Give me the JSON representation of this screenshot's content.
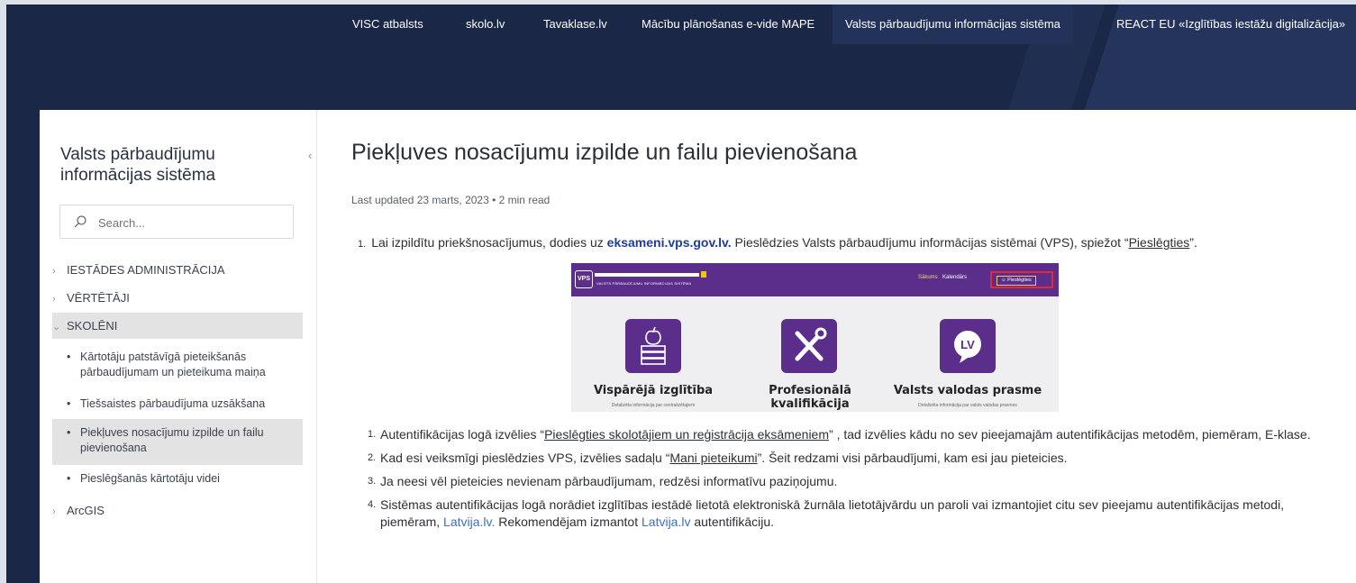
{
  "topnav": {
    "links": [
      {
        "label": "VISC atbalsts"
      },
      {
        "label": "skolo.lv"
      },
      {
        "label": "Tavaklase.lv"
      },
      {
        "label": "Mācību plānošanas e-vide MAPE"
      },
      {
        "label": "Valsts pārbaudījumu informācijas sistēma"
      },
      {
        "label": "REACT EU «Izglītības iestāžu digitalizācija»"
      }
    ]
  },
  "sidebar": {
    "title": "Valsts pārbaudījumu informācijas sistēma",
    "collapse_glyph": "‹",
    "search_placeholder": "Search...",
    "categories": [
      {
        "label": "IESTĀDES ADMINISTRĀCIJA",
        "chev": "›"
      },
      {
        "label": "VĒRTĒTĀJI",
        "chev": "›"
      },
      {
        "label": "SKOLĒNI",
        "chev": "⌄"
      },
      {
        "label": "ArcGIS",
        "chev": "›"
      }
    ],
    "subitems": [
      {
        "label": "Kārtotāju patstāvīgā pieteikšanās pārbaudījumam un pieteikuma maiņa"
      },
      {
        "label": "Tiešsaistes pārbaudījuma uzsākšana"
      },
      {
        "label": "Piekļuves nosacījumu izpilde un failu pievienošana"
      },
      {
        "label": "Pieslēgšanās kārtotāju videi"
      }
    ]
  },
  "article": {
    "title": "Piekļuves nosacījumu izpilde un failu pievienošana",
    "meta": "Last updated 23 marts, 2023  •  2 min read",
    "p1": {
      "num": "1.",
      "a": "Lai izpildītu priekšnosacījumus, dodies uz ",
      "link": "eksameni.vps.gov.lv.",
      "b": " Pieslēdzies Valsts pārbaudījumu informācijas sistēmai (VPS), spiežot “",
      "ulink": "Pieslēgties",
      "c": "”."
    },
    "screenshot": {
      "logo": "VPS",
      "subtitle": "VALSTS PĀRBAUDĪJUMU INFORMĀCIJAS SISTĒMA",
      "nav_home": "Sākums",
      "nav_calendar": "Kalendārs",
      "nav_login": "Pieslēgties",
      "tiles": [
        {
          "title": "Vispārējā izglītība",
          "sub": "Detalizēta informācija par centralizētajiem",
          "icon": "apple-books-icon"
        },
        {
          "title": "Profesionālā kvalifikācija",
          "sub": "",
          "icon": "tools-icon"
        },
        {
          "title": "Valsts valodas prasme",
          "sub": "Detalizēta informācija par valsts valodas prasmes",
          "icon": "lv-speech-icon"
        }
      ],
      "lv_badge": "LV"
    },
    "steps": [
      {
        "num": "1.",
        "a": "Autentifikācijas logā izvēlies “",
        "u": "Pieslēgties skolotājiem un reģistrācija eksāmeniem",
        "b": "” , tad izvēlies kādu no sev pieejamajām autentifikācijas metodēm, piemēram, E-klase."
      },
      {
        "num": "2.",
        "a": "Kad esi veiksmīgi pieslēdzies VPS, izvēlies sadaļu “",
        "u": "Mani pieteikumi",
        "b": "”. Šeit redzami visi pārbaudījumi, kam esi jau pieteicies."
      },
      {
        "num": "3.",
        "a": "Ja neesi vēl pieteicies nevienam pārbaudījumam, redzēsi informatīvu paziņojumu."
      },
      {
        "num": "4.",
        "a": "Sistēmas autentifikācijas logā norādiet izglītības iestādē lietotā elektroniskā žurnāla lietotājvārdu un paroli vai izmantojiet citu sev pieejamu autentifikācijas metodi, piemēram, ",
        "link1": "Latvija.lv.",
        "b": "  Rekomendējam izmantot ",
        "link2": "Latvija.lv",
        "c": " autentifikāciju."
      }
    ]
  }
}
